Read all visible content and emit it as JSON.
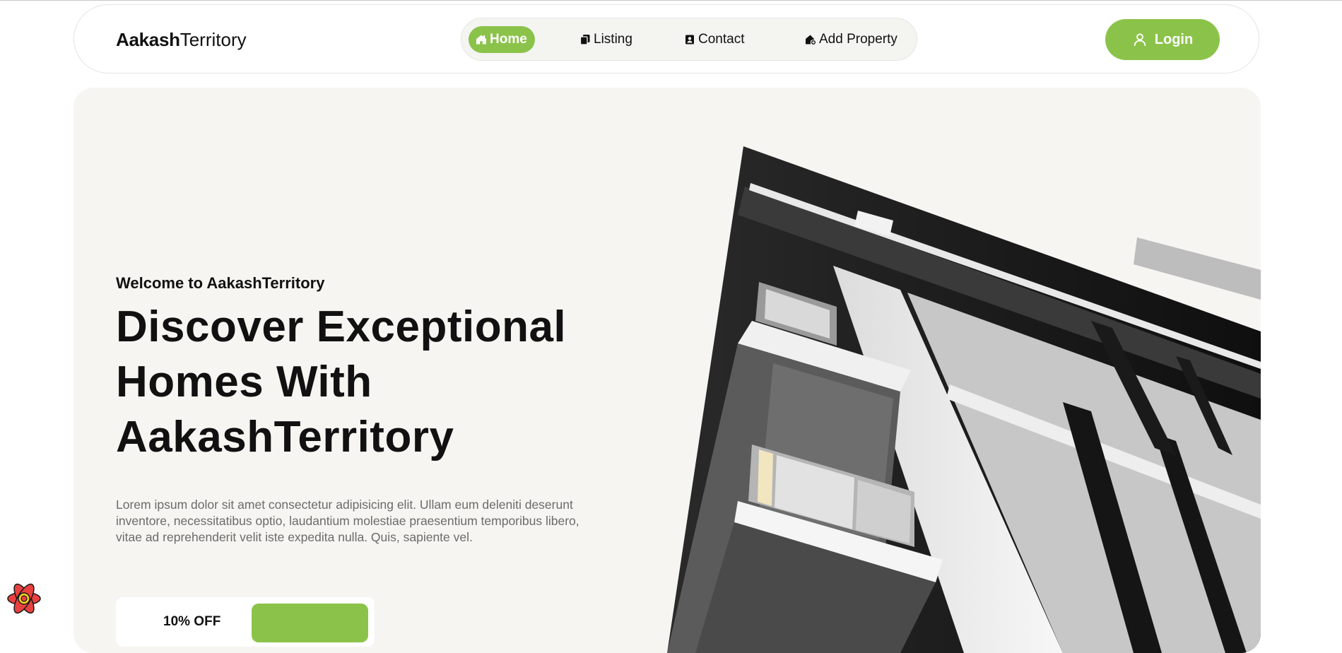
{
  "brand": {
    "strong": "Aakash",
    "light": "Territory"
  },
  "nav": {
    "items": [
      {
        "label": "Home",
        "icon": "house-icon",
        "active": true
      },
      {
        "label": "Listing",
        "icon": "copy-icon",
        "active": false
      },
      {
        "label": "Contact",
        "icon": "contact-card-icon",
        "active": false
      },
      {
        "label": "Add Property",
        "icon": "house-add-icon",
        "active": false
      }
    ]
  },
  "login": {
    "label": "Login",
    "icon": "user-icon"
  },
  "hero": {
    "welcome": "Welcome to AakashTerritory",
    "headline_lines": [
      "Discover Exceptional",
      "Homes With",
      "AakashTerritory"
    ],
    "description": "Lorem ipsum dolor sit amet consectetur adipisicing elit. Ullam eum deleniti deserunt inventore, necessitatibus optio, laudantium molestiae praesentium temporibus libero, vitae ad reprehenderit velit iste expedita nulla. Quis, sapiente vel.",
    "offer_text": "10% OFF",
    "image": "modern-building-photo"
  },
  "colors": {
    "accent": "#8bc34a",
    "hero_bg": "#f6f5f1",
    "muted_text": "#6b6b6b"
  },
  "floating_badge": {
    "icon": "atom-icon"
  }
}
